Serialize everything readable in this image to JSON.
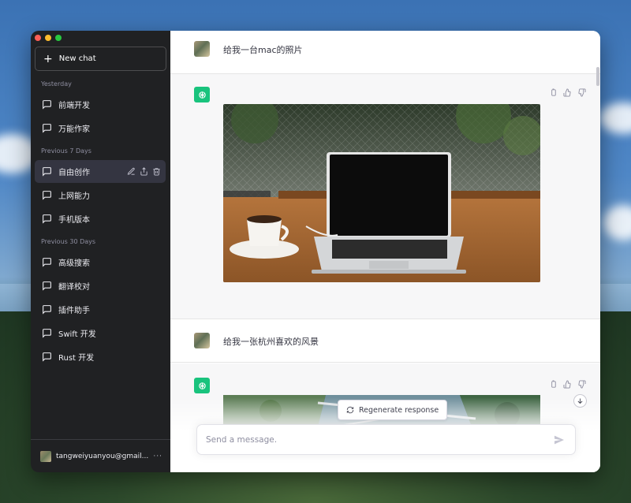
{
  "sidebar": {
    "new_chat": "New chat",
    "sections": [
      {
        "label": "Yesterday",
        "items": [
          "前端开发",
          "万能作家"
        ]
      },
      {
        "label": "Previous 7 Days",
        "items": [
          "自由创作",
          "上网能力",
          "手机版本"
        ]
      },
      {
        "label": "Previous 30 Days",
        "items": [
          "高级搜索",
          "翻译校对",
          "插件助手",
          "Swift 开发",
          "Rust 开发"
        ]
      }
    ],
    "active_item": "自由创作",
    "account": "tangweiyuanyou@gmail...",
    "more": "···"
  },
  "conversation": {
    "messages": [
      {
        "role": "user",
        "text": "给我一台mac的照片"
      },
      {
        "role": "assistant",
        "image": "photo-of-macbook-on-cafe-table"
      },
      {
        "role": "user",
        "text": "给我一张杭州喜欢的风景"
      },
      {
        "role": "assistant",
        "image": "aerial-photo-of-hangzhou-lake"
      }
    ]
  },
  "composer": {
    "placeholder": "Send a message.",
    "regenerate": "Regenerate response"
  },
  "icons": [
    "plus-icon",
    "chat-bubble-icon",
    "edit-icon",
    "share-icon",
    "trash-icon",
    "copy-icon",
    "thumbs-up-icon",
    "thumbs-down-icon",
    "openai-logo-icon",
    "refresh-icon",
    "send-icon",
    "arrow-down-icon"
  ],
  "colors": {
    "sidebar_bg": "#202123",
    "active_item_bg": "#343541",
    "assistant_bg": "#f7f7f8",
    "gpt_green": "#19c37d"
  }
}
